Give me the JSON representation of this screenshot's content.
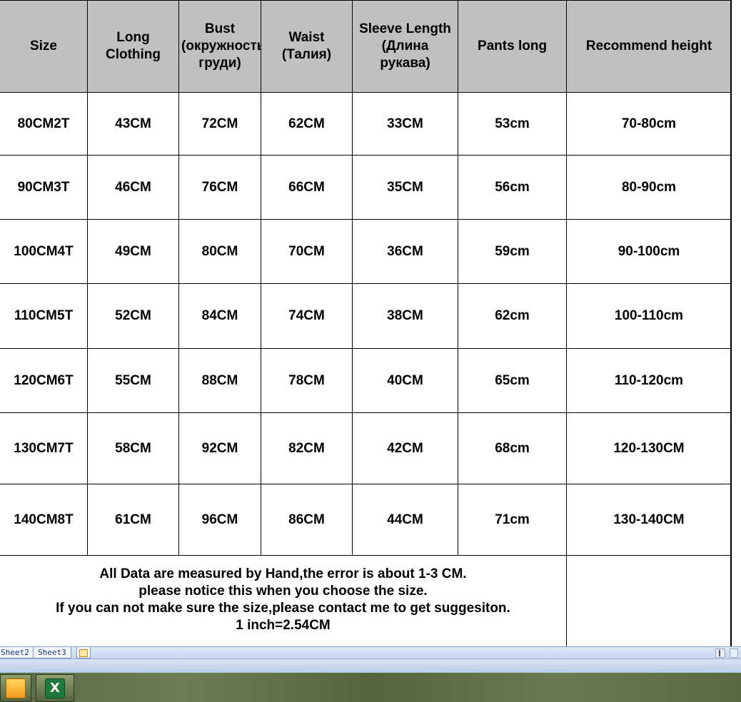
{
  "table": {
    "headers": [
      "Size",
      "Long Clothing",
      "Bust (окружность груди)",
      "Waist (Талия)",
      "Sleeve Length (Длина рукава)",
      "Pants long",
      "Recommend height"
    ],
    "rows": [
      [
        "80CM2T",
        "43CM",
        "72CM",
        "62CM",
        "33CM",
        "53cm",
        "70-80cm"
      ],
      [
        "90CM3T",
        "46CM",
        "76CM",
        "66CM",
        "35CM",
        "56cm",
        "80-90cm"
      ],
      [
        "100CM4T",
        "49CM",
        "80CM",
        "70CM",
        "36CM",
        "59cm",
        "90-100cm"
      ],
      [
        "110CM5T",
        "52CM",
        "84CM",
        "74CM",
        "38CM",
        "62cm",
        "100-110cm"
      ],
      [
        "120CM6T",
        "55CM",
        "88CM",
        "78CM",
        "40CM",
        "65cm",
        "110-120cm"
      ],
      [
        "130CM7T",
        "58CM",
        "92CM",
        "82CM",
        "42CM",
        "68cm",
        "120-130CM"
      ],
      [
        "140CM8T",
        "61CM",
        "96CM",
        "86CM",
        "44CM",
        "71cm",
        "130-140CM"
      ]
    ],
    "note": [
      "All Data are measured by Hand,the error is about 1-3 CM.",
      "please notice this when you choose the size.",
      "If you can not make sure the size,please contact me to get suggesiton.",
      "1 inch=2.54CM"
    ]
  },
  "sheet_tabs": [
    "Sheet2",
    "Sheet3"
  ],
  "taskbar": {
    "apps": [
      "notes-app-icon",
      "excel-icon"
    ],
    "excel_glyph": "X"
  },
  "colors": {
    "header_bg": "#c0c0c0",
    "grid_line": "#000000",
    "tabbar_bg": "#c6d6ee",
    "taskbar_bg": "#5a6a45"
  }
}
